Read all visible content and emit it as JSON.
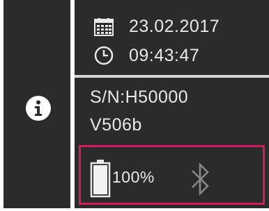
{
  "datetime": {
    "date": "23.02.2017",
    "time": "09:43:47",
    "date_icon": "calendar-icon",
    "time_icon": "clock-icon"
  },
  "device": {
    "serial": "S/N:H50000",
    "version": "V506b"
  },
  "status": {
    "battery_percent": "100%",
    "battery_level": 1.0,
    "battery_icon": "battery-icon",
    "bluetooth_icon": "bluetooth-icon",
    "bluetooth_connected": false
  },
  "sidebar": {
    "icon": "info-icon"
  },
  "colors": {
    "panel_bg": "#2b2b2b",
    "text": "#e9e9e9",
    "highlight_border": "#d81b60",
    "bluetooth_inactive": "#8a8a8a"
  }
}
